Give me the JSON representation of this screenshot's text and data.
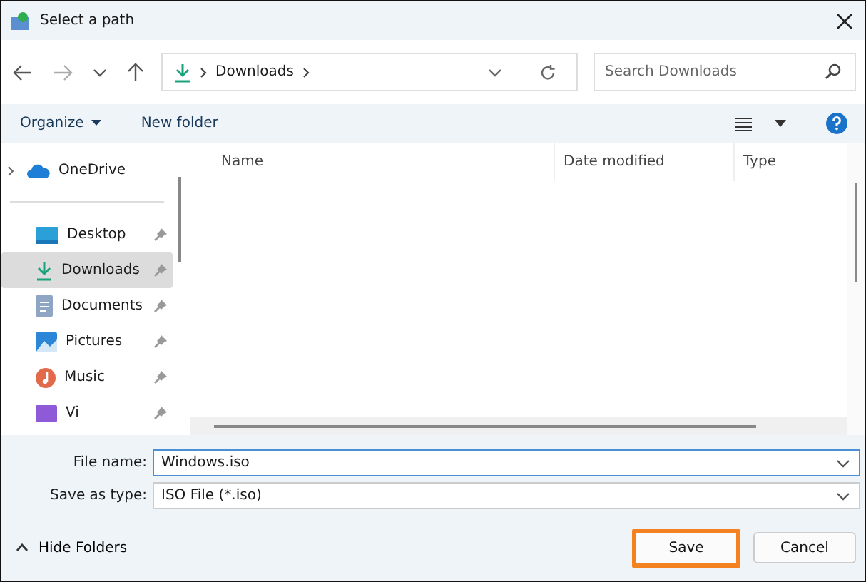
{
  "window": {
    "title": "Select a path"
  },
  "address_bar": {
    "crumbs": [
      "Downloads"
    ]
  },
  "search": {
    "placeholder": "Search Downloads"
  },
  "toolbar": {
    "organize": "Organize",
    "new_folder": "New folder"
  },
  "sidebar": {
    "items": [
      {
        "label": "OneDrive",
        "kind": "cloud",
        "selected": false
      },
      {
        "kind": "divider"
      },
      {
        "label": "Desktop",
        "kind": "desktop",
        "selected": false
      },
      {
        "label": "Downloads",
        "kind": "downloads",
        "selected": true
      },
      {
        "label": "Documents",
        "kind": "documents",
        "selected": false
      },
      {
        "label": "Pictures",
        "kind": "pictures",
        "selected": false
      },
      {
        "label": "Music",
        "kind": "music",
        "selected": false
      },
      {
        "label": "Vi",
        "kind": "videos",
        "selected": false
      }
    ]
  },
  "table": {
    "columns": [
      "Name",
      "Date modified",
      "Type"
    ]
  },
  "fields": [
    {
      "label": "File name:",
      "value": "Windows.iso",
      "focused": true
    },
    {
      "label": "Save as type:",
      "value": "ISO File (*.iso)",
      "focused": false
    }
  ],
  "footer": {
    "hide_folders": "Hide Folders",
    "buttons": [
      {
        "label": "Save",
        "highlighted": true
      },
      {
        "label": "Cancel",
        "highlighted": false
      }
    ]
  }
}
